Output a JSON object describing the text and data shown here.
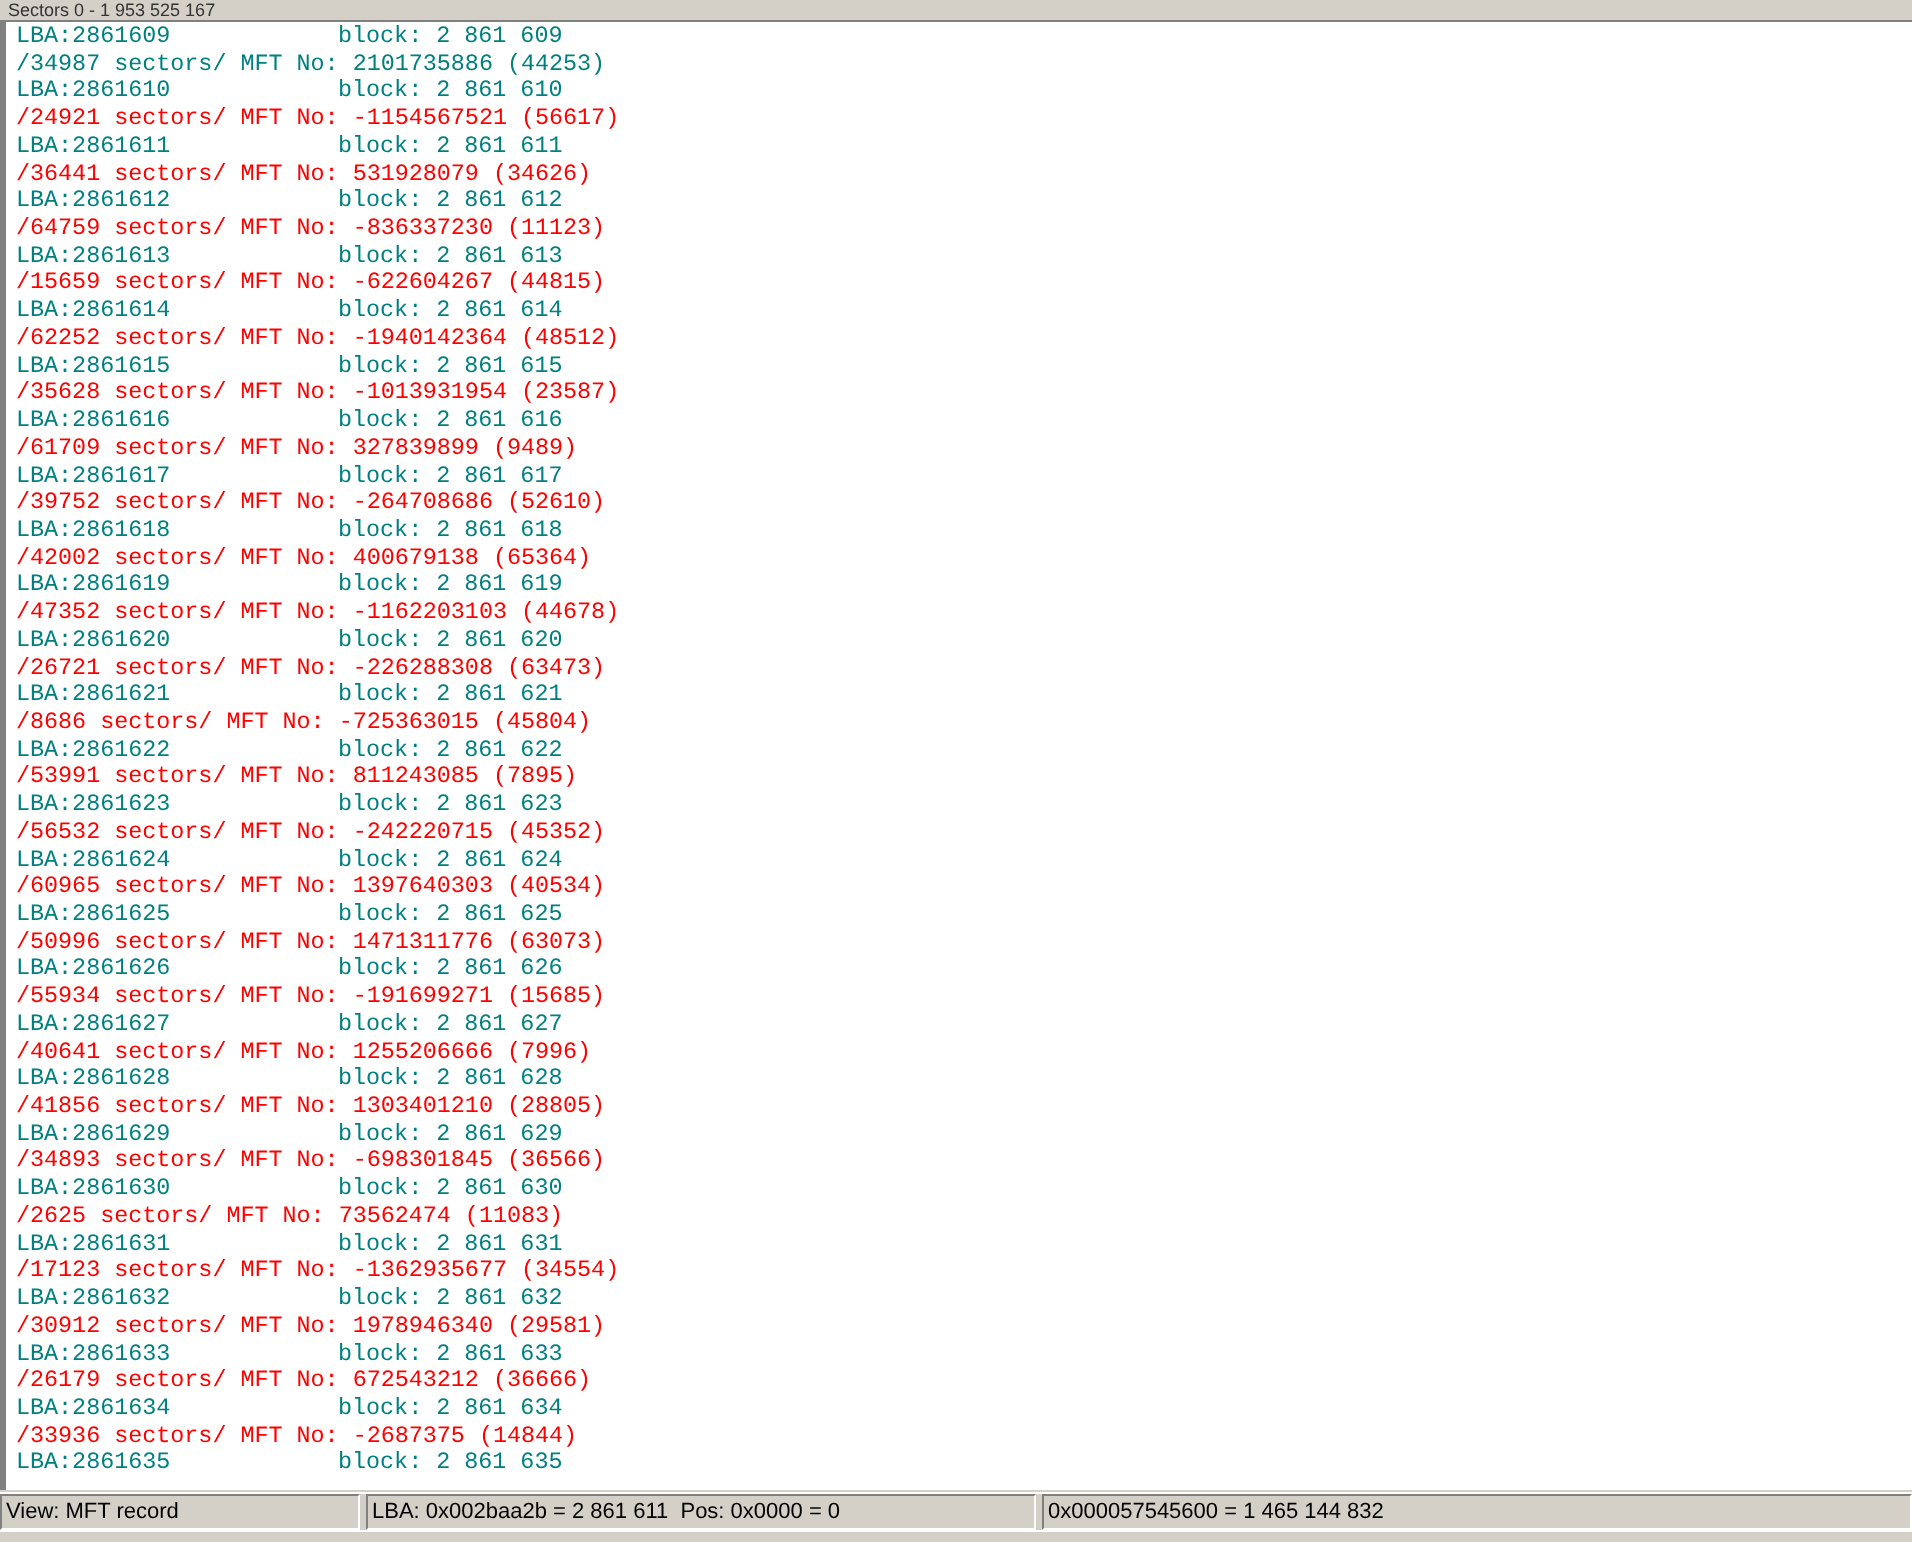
{
  "header": {
    "title": "Sectors 0 - 1 953 525 167"
  },
  "entries": [
    {
      "lba": "LBA:2861609",
      "block": "block: 2 861 609",
      "sectors": "/34987 sectors/ MFT No: 2101735886 (44253)",
      "color": "#008080"
    },
    {
      "lba": "LBA:2861610",
      "block": "block: 2 861 610",
      "sectors": "/24921 sectors/ MFT No: -1154567521 (56617)",
      "color": "#ff0000"
    },
    {
      "lba": "LBA:2861611",
      "block": "block: 2 861 611",
      "sectors": "/36441 sectors/ MFT No: 531928079 (34626)",
      "color": "#ff0000"
    },
    {
      "lba": "LBA:2861612",
      "block": "block: 2 861 612",
      "sectors": "/64759 sectors/ MFT No: -836337230 (11123)",
      "color": "#ff0000"
    },
    {
      "lba": "LBA:2861613",
      "block": "block: 2 861 613",
      "sectors": "/15659 sectors/ MFT No: -622604267 (44815)",
      "color": "#ff0000"
    },
    {
      "lba": "LBA:2861614",
      "block": "block: 2 861 614",
      "sectors": "/62252 sectors/ MFT No: -1940142364 (48512)",
      "color": "#ff0000"
    },
    {
      "lba": "LBA:2861615",
      "block": "block: 2 861 615",
      "sectors": "/35628 sectors/ MFT No: -1013931954 (23587)",
      "color": "#ff0000"
    },
    {
      "lba": "LBA:2861616",
      "block": "block: 2 861 616",
      "sectors": "/61709 sectors/ MFT No: 327839899 (9489)",
      "color": "#ff0000"
    },
    {
      "lba": "LBA:2861617",
      "block": "block: 2 861 617",
      "sectors": "/39752 sectors/ MFT No: -264708686 (52610)",
      "color": "#ff0000"
    },
    {
      "lba": "LBA:2861618",
      "block": "block: 2 861 618",
      "sectors": "/42002 sectors/ MFT No: 400679138 (65364)",
      "color": "#ff0000"
    },
    {
      "lba": "LBA:2861619",
      "block": "block: 2 861 619",
      "sectors": "/47352 sectors/ MFT No: -1162203103 (44678)",
      "color": "#ff0000"
    },
    {
      "lba": "LBA:2861620",
      "block": "block: 2 861 620",
      "sectors": "/26721 sectors/ MFT No: -226288308 (63473)",
      "color": "#ff0000"
    },
    {
      "lba": "LBA:2861621",
      "block": "block: 2 861 621",
      "sectors": "/8686 sectors/ MFT No: -725363015 (45804)",
      "color": "#ff0000"
    },
    {
      "lba": "LBA:2861622",
      "block": "block: 2 861 622",
      "sectors": "/53991 sectors/ MFT No: 811243085 (7895)",
      "color": "#ff0000"
    },
    {
      "lba": "LBA:2861623",
      "block": "block: 2 861 623",
      "sectors": "/56532 sectors/ MFT No: -242220715 (45352)",
      "color": "#ff0000"
    },
    {
      "lba": "LBA:2861624",
      "block": "block: 2 861 624",
      "sectors": "/60965 sectors/ MFT No: 1397640303 (40534)",
      "color": "#ff0000"
    },
    {
      "lba": "LBA:2861625",
      "block": "block: 2 861 625",
      "sectors": "/50996 sectors/ MFT No: 1471311776 (63073)",
      "color": "#ff0000"
    },
    {
      "lba": "LBA:2861626",
      "block": "block: 2 861 626",
      "sectors": "/55934 sectors/ MFT No: -191699271 (15685)",
      "color": "#ff0000"
    },
    {
      "lba": "LBA:2861627",
      "block": "block: 2 861 627",
      "sectors": "/40641 sectors/ MFT No: 1255206666 (7996)",
      "color": "#ff0000"
    },
    {
      "lba": "LBA:2861628",
      "block": "block: 2 861 628",
      "sectors": "/41856 sectors/ MFT No: 1303401210 (28805)",
      "color": "#ff0000"
    },
    {
      "lba": "LBA:2861629",
      "block": "block: 2 861 629",
      "sectors": "/34893 sectors/ MFT No: -698301845 (36566)",
      "color": "#ff0000"
    },
    {
      "lba": "LBA:2861630",
      "block": "block: 2 861 630",
      "sectors": "/2625 sectors/ MFT No: 73562474 (11083)",
      "color": "#ff0000"
    },
    {
      "lba": "LBA:2861631",
      "block": "block: 2 861 631",
      "sectors": "/17123 sectors/ MFT No: -1362935677 (34554)",
      "color": "#ff0000"
    },
    {
      "lba": "LBA:2861632",
      "block": "block: 2 861 632",
      "sectors": "/30912 sectors/ MFT No: 1978946340 (29581)",
      "color": "#ff0000"
    },
    {
      "lba": "LBA:2861633",
      "block": "block: 2 861 633",
      "sectors": "/26179 sectors/ MFT No: 672543212 (36666)",
      "color": "#ff0000"
    },
    {
      "lba": "LBA:2861634",
      "block": "block: 2 861 634",
      "sectors": "/33936 sectors/ MFT No: -2687375 (14844)",
      "color": "#ff0000"
    },
    {
      "lba": "LBA:2861635",
      "block": "block: 2 861 635"
    }
  ],
  "status_bar": [
    "View: MFT record",
    "LBA: 0x002baa2b = 2 861 611  Pos: 0x0000 = 0",
    "0x000057545600 = 1 465 144 832"
  ]
}
